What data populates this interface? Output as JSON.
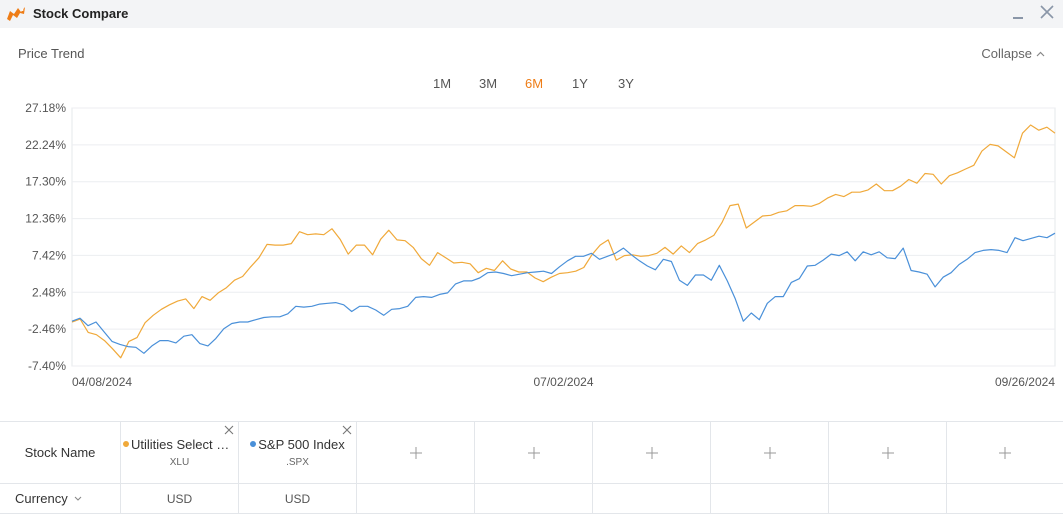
{
  "window": {
    "title": "Stock Compare",
    "logo_icon": "bull-logo-icon",
    "accent": "#ee7d17"
  },
  "section": {
    "title": "Price Trend",
    "collapse_label": "Collapse"
  },
  "ranges": [
    {
      "label": "1M",
      "active": false
    },
    {
      "label": "3M",
      "active": false
    },
    {
      "label": "6M",
      "active": true
    },
    {
      "label": "1Y",
      "active": false
    },
    {
      "label": "3Y",
      "active": false
    }
  ],
  "chart_data": {
    "type": "line",
    "x_tick_labels": [
      "04/08/2024",
      "07/02/2024",
      "09/26/2024"
    ],
    "y_tick_labels": [
      "27.18%",
      "22.24%",
      "17.30%",
      "12.36%",
      "7.42%",
      "2.48%",
      "-2.46%",
      "-7.40%"
    ],
    "y_ticks": [
      27.18,
      22.24,
      17.3,
      12.36,
      7.42,
      2.48,
      -2.46,
      -7.4
    ],
    "ylim": [
      -7.4,
      27.18
    ],
    "grid": "horizontal",
    "series": [
      {
        "name": "Utilities Select Sector SPDR",
        "symbol": "XLU",
        "color": "#f0a93a",
        "values": [
          -1.5,
          -1.1,
          -2.9,
          -3.2,
          -4.0,
          -5.1,
          -6.3,
          -4.1,
          -3.6,
          -1.6,
          -0.6,
          0.2,
          0.8,
          1.3,
          1.6,
          0.3,
          1.9,
          1.4,
          2.4,
          3.1,
          4.1,
          4.6,
          5.9,
          7.1,
          8.9,
          8.8,
          8.8,
          9.0,
          10.6,
          10.2,
          10.3,
          10.2,
          11.0,
          9.6,
          7.6,
          8.8,
          8.8,
          7.5,
          9.6,
          10.8,
          9.5,
          9.4,
          8.5,
          7.0,
          6.1,
          7.8,
          7.1,
          6.4,
          6.5,
          6.3,
          5.1,
          5.7,
          5.4,
          6.7,
          5.6,
          5.2,
          5.2,
          4.4,
          3.9,
          4.5,
          5.0,
          5.1,
          5.3,
          5.8,
          7.5,
          8.8,
          9.5,
          6.8,
          7.4,
          7.5,
          7.3,
          7.4,
          7.7,
          8.5,
          7.6,
          8.7,
          7.8,
          9.0,
          9.5,
          10.1,
          11.8,
          14.1,
          14.3,
          11.1,
          11.9,
          12.7,
          12.8,
          13.2,
          13.4,
          14.1,
          14.1,
          14.0,
          14.4,
          15.1,
          15.6,
          15.3,
          15.9,
          15.9,
          16.2,
          17.0,
          16.1,
          16.1,
          16.7,
          17.6,
          17.1,
          18.4,
          18.3,
          17.0,
          18.1,
          18.5,
          19.0,
          19.5,
          21.4,
          22.3,
          22.1,
          21.3,
          20.5,
          23.8,
          24.9,
          24.2,
          24.6,
          23.8
        ]
      },
      {
        "name": "S&P 500 Index",
        "symbol": ".SPX",
        "color": "#4a90d9",
        "values": [
          -1.4,
          -1.0,
          -2.0,
          -1.5,
          -2.8,
          -4.1,
          -4.5,
          -4.8,
          -4.9,
          -5.7,
          -4.7,
          -4.0,
          -4.0,
          -4.3,
          -3.4,
          -3.2,
          -4.4,
          -4.7,
          -3.7,
          -2.4,
          -1.7,
          -1.5,
          -1.5,
          -1.2,
          -0.9,
          -0.8,
          -0.8,
          -0.4,
          0.6,
          0.5,
          0.6,
          0.9,
          1.0,
          1.1,
          0.8,
          -0.1,
          0.6,
          0.6,
          0.1,
          -0.6,
          0.2,
          0.3,
          0.6,
          1.8,
          1.9,
          1.8,
          2.2,
          2.4,
          3.6,
          4.0,
          4.0,
          4.4,
          5.1,
          5.2,
          5.0,
          4.7,
          4.9,
          5.1,
          5.2,
          5.3,
          5.0,
          5.9,
          6.7,
          7.3,
          7.3,
          7.7,
          6.9,
          7.3,
          7.7,
          8.4,
          7.5,
          6.7,
          6.0,
          5.5,
          6.9,
          6.6,
          4.1,
          3.4,
          4.8,
          4.8,
          4.1,
          6.1,
          4.0,
          1.6,
          -1.4,
          -0.3,
          -1.2,
          1.0,
          1.9,
          1.9,
          3.8,
          4.3,
          6.0,
          6.1,
          6.8,
          7.6,
          7.4,
          7.9,
          6.7,
          7.9,
          7.5,
          7.9,
          7.1,
          7.0,
          8.4,
          5.4,
          5.2,
          4.9,
          3.2,
          4.5,
          5.1,
          6.2,
          6.9,
          7.8,
          8.1,
          8.2,
          8.1,
          7.8,
          9.8,
          9.4,
          9.7,
          10.0,
          9.8,
          10.4
        ]
      }
    ]
  },
  "compare_table": {
    "row_header_stock": "Stock Name",
    "row_header_currency": "Currency",
    "stocks": [
      {
        "dot_color": "#f0a93a",
        "name": "Utilities Select Sector SPDR",
        "symbol": "XLU",
        "currency": "USD"
      },
      {
        "dot_color": "#4a90d9",
        "name": "S&P 500 Index",
        "symbol": ".SPX",
        "currency": "USD"
      }
    ],
    "empty_slots": 6
  }
}
